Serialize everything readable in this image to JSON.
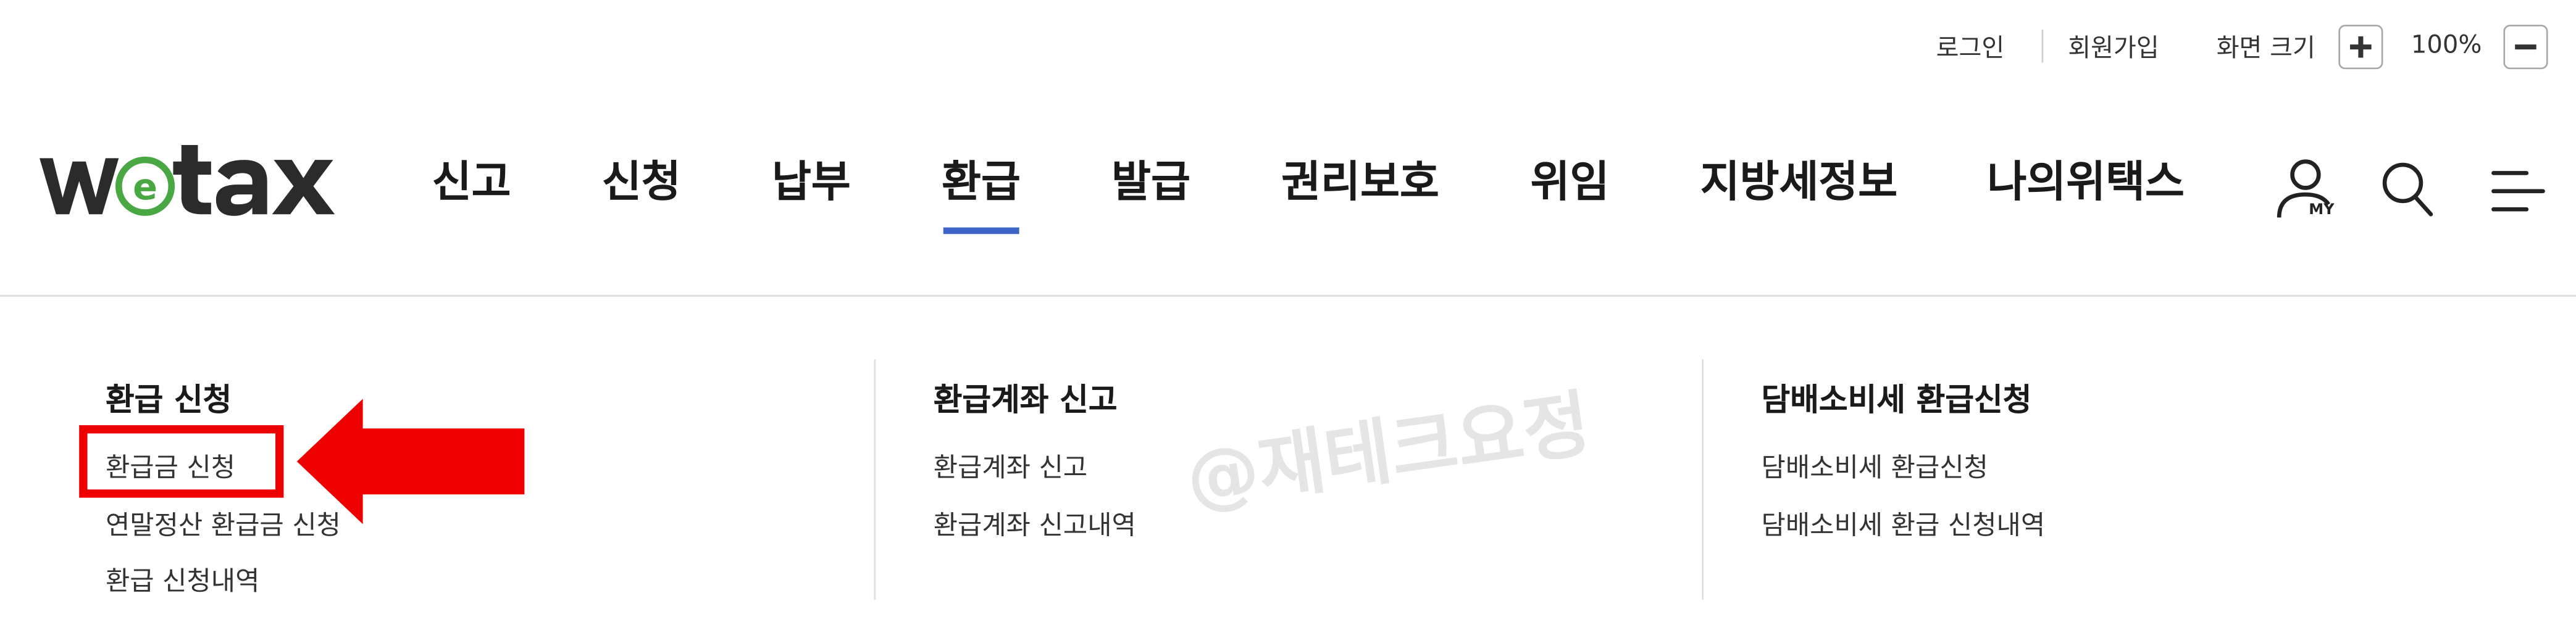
{
  "utility": {
    "login": "로그인",
    "signup": "회원가입",
    "screen_size_label": "화면 크기",
    "zoom_in": "+",
    "zoom_level": "100%",
    "zoom_out": "−"
  },
  "logo": {
    "text": "wetax",
    "colors": {
      "dark": "#2b2b2b",
      "green": "#49a843"
    }
  },
  "nav": {
    "items": [
      {
        "label": "신고"
      },
      {
        "label": "신청"
      },
      {
        "label": "납부"
      },
      {
        "label": "환급",
        "active": true
      },
      {
        "label": "발급"
      },
      {
        "label": "권리보호"
      },
      {
        "label": "위임"
      },
      {
        "label": "지방세정보"
      },
      {
        "label": "나의위택스"
      }
    ],
    "my_badge": "MY",
    "active_color": "#3d63c9"
  },
  "dropdown": {
    "columns": [
      {
        "title": "환급 신청",
        "links": [
          "환급금 신청",
          "연말정산 환급금 신청",
          "환급 신청내역"
        ]
      },
      {
        "title": "환급계좌 신고",
        "links": [
          "환급계좌 신고",
          "환급계좌 신고내역"
        ]
      },
      {
        "title": "담배소비세 환급신청",
        "links": [
          "담배소비세 환급신청",
          "담배소비세 환급 신청내역"
        ]
      }
    ]
  },
  "watermark": "@재테크요정",
  "annotation_color": "#ee0000"
}
